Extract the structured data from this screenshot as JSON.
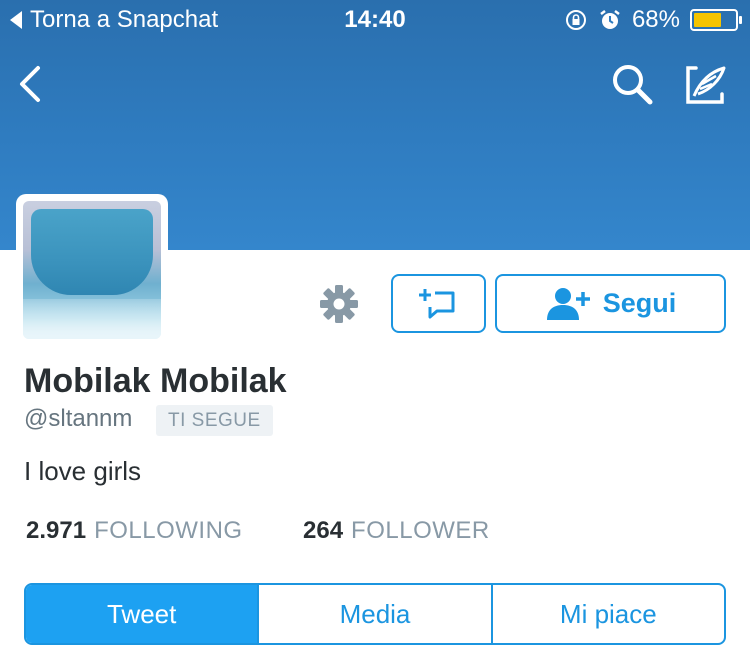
{
  "status_bar": {
    "back_label": "Torna a Snapchat",
    "time": "14:40",
    "battery": "68%",
    "battery_level": 0.68,
    "battery_color": "#f5c400",
    "icons": [
      "rotation-lock-icon",
      "alarm-icon",
      "battery-icon"
    ]
  },
  "nav": {
    "icons": [
      "back-chevron-icon",
      "search-icon",
      "compose-tweet-icon"
    ]
  },
  "colors": {
    "header": "#2f7cc0",
    "accent": "#1b95e0",
    "active_tab": "#1da1f2",
    "text": "#292f33",
    "muted": "#8899a6"
  },
  "profile": {
    "name": "Mobilak Mobilak",
    "handle": "@sltannm",
    "follows_you": "TI SEGUE",
    "bio": "I love girls",
    "following_count": "2.971",
    "following_label": "FOLLOWING",
    "followers_count": "264",
    "followers_label": "FOLLOWER"
  },
  "actions": {
    "follow_label": "Segui",
    "icons": [
      "settings-gear-icon",
      "direct-message-icon",
      "add-user-icon"
    ]
  },
  "tabs": [
    {
      "label": "Tweet",
      "active": true
    },
    {
      "label": "Media",
      "active": false
    },
    {
      "label": "Mi piace",
      "active": false
    }
  ]
}
